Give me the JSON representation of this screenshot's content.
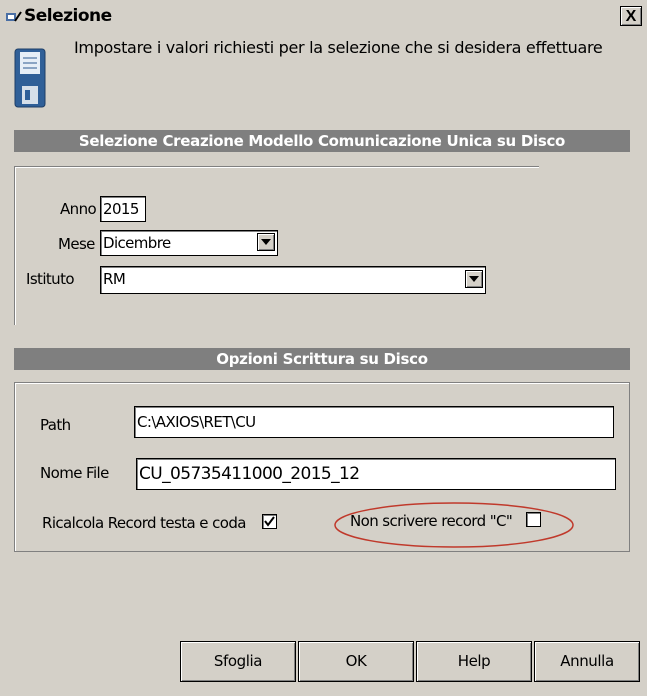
{
  "window": {
    "title": "Selezione",
    "close_label": "X"
  },
  "instructions": "Impostare i valori richiesti per la selezione che si desidera effettuare",
  "section1": {
    "header": "Selezione Creazione Modello Comunicazione Unica su Disco",
    "anno_label": "Anno",
    "anno_value": "2015",
    "mese_label": "Mese",
    "mese_value": "Dicembre",
    "istituto_label": "Istituto",
    "istituto_value": "RM"
  },
  "section2": {
    "header": "Opzioni Scrittura su Disco",
    "path_label": "Path",
    "path_value": "C:\\AXIOS\\RET\\CU",
    "nome_file_label": "Nome File",
    "nome_file_value": "CU_05735411000_2015_12",
    "ricalcola_label": "Ricalcola Record testa e coda",
    "ricalcola_checked": true,
    "non_scrivere_label": "Non scrivere record \"C\"",
    "non_scrivere_checked": false
  },
  "buttons": {
    "sfoglia": "Sfoglia",
    "ok": "OK",
    "help": "Help",
    "annulla": "Annulla"
  },
  "colors": {
    "section_header_bg": "#7f7f7f",
    "window_bg": "#d4d0c8",
    "highlight_ellipse": "#c0392b"
  }
}
